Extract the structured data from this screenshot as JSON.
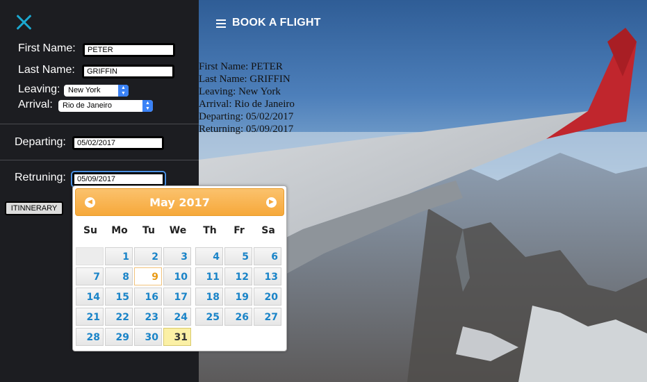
{
  "header": {
    "title": "BOOK A FLIGHT"
  },
  "form": {
    "first_name_label": "First Name:",
    "first_name_value": "PETER",
    "last_name_label": "Last Name:",
    "last_name_value": "GRIFFIN",
    "leaving_label": "Leaving:",
    "leaving_value": "New York",
    "arrival_label": "Arrival:",
    "arrival_value": "Rio de Janeiro",
    "departing_label": "Departing:",
    "departing_value": "05/02/2017",
    "returning_label": "Retruning:",
    "returning_value": "05/09/2017",
    "itinerary_button": "ITINNERARY"
  },
  "summary": [
    "First Name: PETER",
    "Last Name: GRIFFIN",
    "Leaving: New York",
    "Arrival: Rio de Janeiro",
    "Departing: 05/02/2017",
    "Returning: 05/09/2017"
  ],
  "datepicker": {
    "title": "May 2017",
    "prev_icon": "chevron-left-icon",
    "next_icon": "chevron-right-icon",
    "weekdays": [
      "Su",
      "Mo",
      "Tu",
      "We",
      "Th",
      "Fr",
      "Sa"
    ],
    "first_weekday_index": 1,
    "days_in_month": 31,
    "today": 9,
    "selected": 31
  },
  "colors": {
    "accent": "#1ba8d0",
    "header_orange": "#f6a83a",
    "day_blue": "#1a84c8",
    "today_orange": "#e89a15",
    "selected_yellow": "#fbf0a5"
  }
}
